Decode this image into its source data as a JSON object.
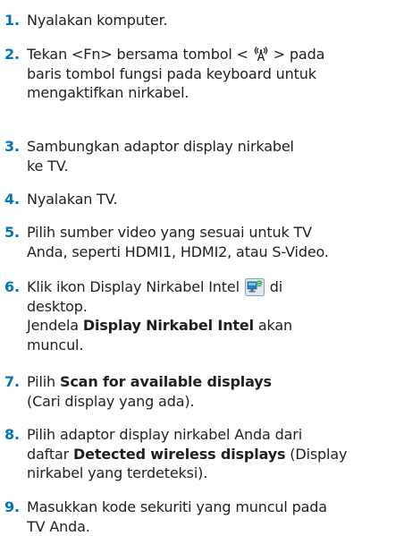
{
  "steps": [
    {
      "number": "1.",
      "lines": [
        {
          "t": "Nyalakan komputer."
        }
      ]
    },
    {
      "number": "2.",
      "lines": [
        {
          "a": "Tekan <Fn> bersama tombol < ",
          "icon": "wireless-antenna-icon",
          "b": " > pada"
        },
        {
          "t": "baris tombol fungsi pada keyboard untuk"
        },
        {
          "t": "mengaktifkan nirkabel."
        }
      ]
    },
    {
      "number": "3.",
      "lines": [
        {
          "t": "Sambungkan adaptor display nirkabel"
        },
        {
          "t": "ke TV."
        }
      ]
    },
    {
      "number": "4.",
      "lines": [
        {
          "t": "Nyalakan TV."
        }
      ]
    },
    {
      "number": "5.",
      "lines": [
        {
          "t": "Pilih sumber video yang sesuai untuk TV"
        },
        {
          "t": "Anda, seperti HDMI1, HDMI2, atau S-Video."
        }
      ]
    },
    {
      "number": "6.",
      "lines": [
        {
          "a": "Klik ikon Display Nirkabel Intel ",
          "icon": "intel-wireless-display-icon",
          "b": " di"
        },
        {
          "t": "desktop."
        },
        {
          "bold": "Display Nirkabel Intel",
          "pre": "Jendela ",
          "post": " akan"
        },
        {
          "t": "muncul."
        }
      ]
    },
    {
      "number": "7.",
      "lines": [
        {
          "pre": "Pilih ",
          "bold": "Scan for available displays",
          "post": ""
        },
        {
          "t": "(Cari display yang ada)."
        }
      ]
    },
    {
      "number": "8.",
      "lines": [
        {
          "t": "Pilih adaptor display nirkabel Anda dari"
        },
        {
          "pre": "daftar ",
          "bold": "Detected wireless displays",
          "post": " (Display"
        },
        {
          "t": "nirkabel yang terdeteksi)."
        }
      ]
    },
    {
      "number": "9.",
      "lines": [
        {
          "t": "Masukkan kode sekuriti yang muncul pada"
        },
        {
          "t": "TV Anda."
        }
      ]
    }
  ],
  "colors": {
    "number": "#0077b6",
    "text": "#231f20"
  }
}
